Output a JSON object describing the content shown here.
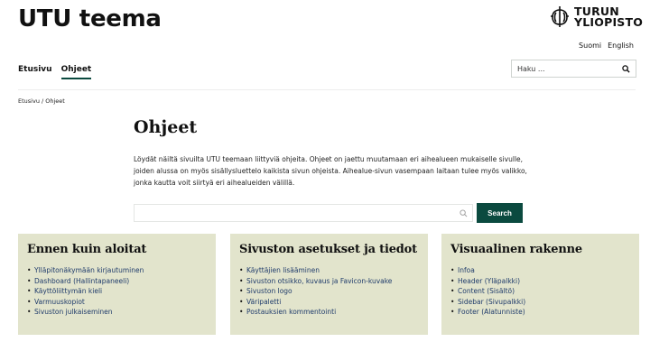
{
  "header": {
    "site_title": "UTU teema",
    "logo_line1": "TURUN",
    "logo_line2": "YLIOPISTO",
    "languages": [
      "Suomi",
      "English"
    ]
  },
  "nav": {
    "items": [
      "Etusivu",
      "Ohjeet"
    ],
    "active": "Ohjeet"
  },
  "search": {
    "placeholder": "Haku ..."
  },
  "breadcrumb": "Etusivu / Ohjeet",
  "page": {
    "title": "Ohjeet",
    "intro": "Löydät näiltä sivuilta UTU teemaan liittyviä ohjeita. Ohjeet on jaettu muutamaan eri aihealueen mukaiselle sivulle, joiden alussa on myös sisällysluettelo kaikista sivun ohjeista. Aihealue-sivun vasempaan laitaan tulee myös valikko, jonka kautta voit siirtyä eri aihealueiden välillä.",
    "search_button": "Search"
  },
  "cards": [
    {
      "title": "Ennen kuin aloitat",
      "links": [
        "Ylläpitonäkymään kirjautuminen",
        "Dashboard (Hallintapaneeli)",
        "Käyttöliittymän kieli",
        "Varmuuskopiot",
        "Sivuston julkaiseminen"
      ]
    },
    {
      "title": "Sivuston asetukset ja tiedot",
      "links": [
        "Käyttäjien lisääminen",
        "Sivuston otsikko, kuvaus ja Favicon-kuvake",
        "Sivuston logo",
        "Väripaletti",
        "Postauksien kommentointi"
      ]
    },
    {
      "title": "Visuaalinen rakenne",
      "links": [
        "Infoa",
        "Header (Yläpalkki)",
        "Content (Sisältö)",
        "Sidebar (Sivupalkki)",
        "Footer (Alatunniste)"
      ]
    }
  ],
  "colors": {
    "accent": "#0b4a3f",
    "card_background": "#e2e4cc",
    "link": "#1f3b6b"
  },
  "icons": [
    "search-icon",
    "university-logo"
  ]
}
